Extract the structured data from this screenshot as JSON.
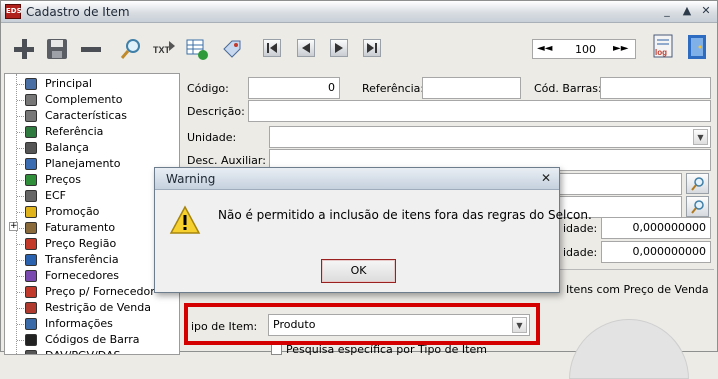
{
  "window": {
    "title": "Cadastro de Item",
    "app_badge": "EDS",
    "minimize": "_",
    "maximize": "▲",
    "close": "✕"
  },
  "toolbar": {
    "icons": [
      "add-icon",
      "save-icon",
      "remove-icon",
      "search-icon",
      "txt-export-icon",
      "grid-refresh-icon",
      "tag-icon",
      "first-record-icon",
      "previous-record-icon",
      "next-record-icon",
      "last-record-icon",
      "log-icon",
      "exit-icon"
    ],
    "txt_label": "TXT",
    "log_label": "log",
    "pager": {
      "first": "◄◄",
      "value": "100",
      "last": "►►"
    }
  },
  "tree": {
    "expand_symbol": "+",
    "items": [
      {
        "label": "Principal",
        "icon": "list-icon"
      },
      {
        "label": "Complemento",
        "icon": "paperclip-icon"
      },
      {
        "label": "Características",
        "icon": "paperclip-icon"
      },
      {
        "label": "Referência",
        "icon": "hierarchy-icon"
      },
      {
        "label": "Balança",
        "icon": "scale-icon"
      },
      {
        "label": "Planejamento",
        "icon": "calendar-icon"
      },
      {
        "label": "Preços",
        "icon": "money-icon"
      },
      {
        "label": "ECF",
        "icon": "printer-icon"
      },
      {
        "label": "Promoção",
        "icon": "star-icon"
      },
      {
        "label": "Faturamento",
        "icon": "invoice-icon"
      },
      {
        "label": "Preço Região",
        "icon": "region-icon"
      },
      {
        "label": "Transferência",
        "icon": "transfer-icon"
      },
      {
        "label": "Fornecedores",
        "icon": "suppliers-icon"
      },
      {
        "label": "Preço p/ Fornecedor",
        "icon": "supplier-price-icon"
      },
      {
        "label": "Restrição de Venda",
        "icon": "restriction-icon"
      },
      {
        "label": "Informações",
        "icon": "info-icon"
      },
      {
        "label": "Códigos de Barra",
        "icon": "barcode-icon"
      },
      {
        "label": "DAV/PGV/DAS",
        "icon": "document-icon"
      }
    ]
  },
  "form": {
    "codigo_label": "Código:",
    "codigo_value": "0",
    "referencia_label": "Referência:",
    "cod_barras_label": "Cód. Barras:",
    "descricao_label": "Descrição:",
    "unidade_label": "Unidade:",
    "desc_auxiliar_label": "Desc. Auxiliar:",
    "qty1_label": "idade:",
    "qty1_value": "0,000000000",
    "qty2_label": "idade:",
    "qty2_value": "0,000000000",
    "itens_preco_label": "Itens com Preço de Venda",
    "tipo_item_label": "ipo de Item:",
    "tipo_item_value": "Produto",
    "pesquisa_label": "Pesquisa específica por Tipo de Item"
  },
  "dialog": {
    "title": "Warning",
    "message": "Não é permitido a inclusão de itens fora das regras do Selcon.",
    "ok_label": "OK",
    "icon": "warning-icon"
  },
  "colors": {
    "highlight_box": "#d40000",
    "window_bg": "#ecebe6"
  }
}
